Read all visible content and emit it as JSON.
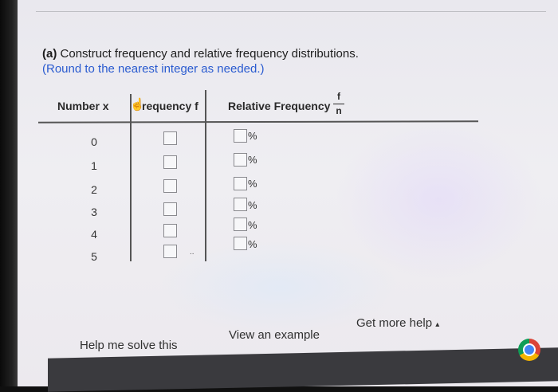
{
  "question": {
    "part": "(a)",
    "prompt": "Construct frequency and relative frequency distributions.",
    "hint": "(Round to the nearest integer as needed.)"
  },
  "table": {
    "col_number": "Number x",
    "col_frequency": "requency f",
    "col_relative": "Relative Frequency",
    "frac_num": "f",
    "frac_den": "n",
    "percent_sign": "%",
    "rows": [
      {
        "x": "0",
        "frequency": "",
        "relative": ""
      },
      {
        "x": "1",
        "frequency": "",
        "relative": ""
      },
      {
        "x": "2",
        "frequency": "",
        "relative": ""
      },
      {
        "x": "3",
        "frequency": "",
        "relative": ""
      },
      {
        "x": "4",
        "frequency": "",
        "relative": ""
      },
      {
        "x": "5",
        "frequency": "",
        "relative": ""
      }
    ]
  },
  "footer": {
    "help_solve": "Help me solve this",
    "view_example": "View an example",
    "get_help": "Get more help",
    "get_help_caret": "▴"
  },
  "colors": {
    "hint": "#2a5bd0",
    "text": "#1d1d1d",
    "taskbar": "#3a3a3e"
  },
  "icons": {
    "cursor": "hand-pointer-icon",
    "browser": "chrome-icon"
  }
}
